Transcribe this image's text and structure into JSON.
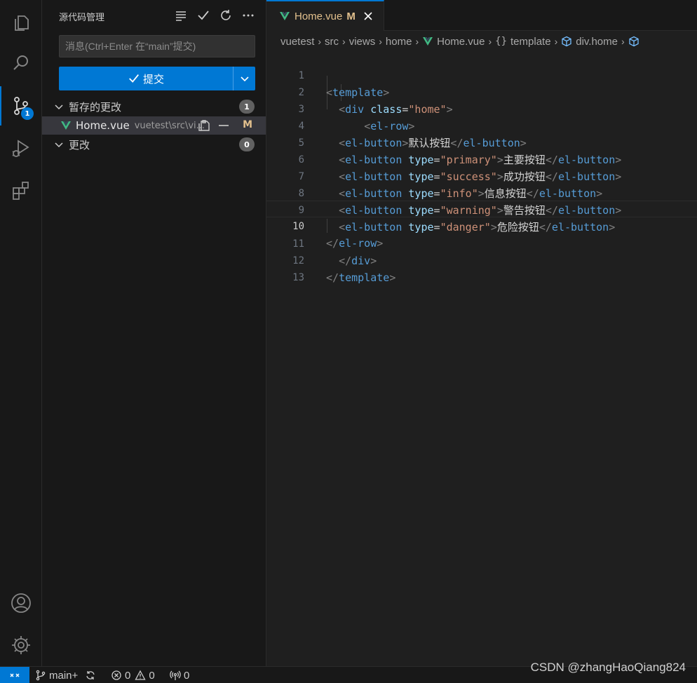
{
  "activity_bar": {
    "scm_badge": "1"
  },
  "sidebar": {
    "title": "源代码管理",
    "message_placeholder": "消息(Ctrl+Enter 在“main”提交)",
    "commit_label": "提交",
    "staged_section": {
      "label": "暂存的更改",
      "count": "1",
      "files": [
        {
          "name": "Home.vue",
          "path": "vuetest\\src\\vi...",
          "status": "M"
        }
      ]
    },
    "changes_section": {
      "label": "更改",
      "count": "0"
    }
  },
  "editor": {
    "tab": {
      "name": "Home.vue",
      "modified": "M"
    },
    "breadcrumb": [
      "vuetest",
      "src",
      "views",
      "home",
      "Home.vue",
      "template",
      "div.home"
    ],
    "line_numbers": [
      "1",
      "2",
      "3",
      "4",
      "5",
      "6",
      "7",
      "8",
      "9",
      "10",
      "11",
      "12",
      "13"
    ],
    "current_line": "10",
    "code": {
      "l1_tag": "template",
      "l2_tag": "div",
      "l2_attr": "class",
      "l2_val": "\"home\"",
      "l3_tag": "el-row",
      "l4_tag": "el-button",
      "l4_text": "默认按钮",
      "l4_close": "el-button",
      "l5_tag": "el-button",
      "l5_attr": "type",
      "l5_val": "\"primary\"",
      "l5_text": "主要按钮",
      "l5_close": "el-button",
      "l6_tag": "el-button",
      "l6_attr": "type",
      "l6_val": "\"success\"",
      "l6_text": "成功按钮",
      "l6_close": "el-button",
      "l7_tag": "el-button",
      "l7_attr": "type",
      "l7_val": "\"info\"",
      "l7_text": "信息按钮",
      "l7_close": "el-button",
      "l8_tag": "el-button",
      "l8_attr": "type",
      "l8_val": "\"warning\"",
      "l8_text": "警告按钮",
      "l8_close": "el-button",
      "l9_tag": "el-button",
      "l9_attr": "type",
      "l9_val": "\"danger\"",
      "l9_text": "危险按钮",
      "l9_close": "el-button",
      "l10_close": "el-row",
      "l11_close": "div",
      "l12_close": "template"
    }
  },
  "status_bar": {
    "branch": "main+",
    "errors": "0",
    "warnings": "0",
    "ports": "0"
  },
  "watermark": "CSDN @zhangHaoQiang824",
  "colors": {
    "accent": "#0078d4",
    "modified": "#e2c08d",
    "vue_green": "#41b883",
    "tag": "#569cd6",
    "attribute": "#9cdcfe",
    "string": "#ce9178"
  }
}
